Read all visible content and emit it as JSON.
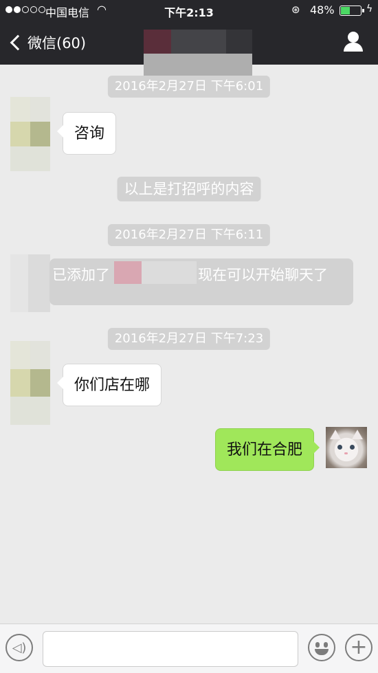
{
  "status_bar": {
    "signal_dots_filled": 2,
    "signal_dots_total": 5,
    "carrier": "中国电信",
    "time": "下午2:13",
    "battery_percent": "48%",
    "battery_level": 0.48,
    "wifi_icon": "wifi-icon",
    "lock_icon": "rotation-lock-icon"
  },
  "nav": {
    "back_label": "微信(60)",
    "profile_icon": "person-icon"
  },
  "messages": [
    {
      "type": "timestamp",
      "text": "2016年2月27日 下午6:01"
    },
    {
      "type": "received",
      "text": "咨询"
    },
    {
      "type": "system",
      "text": "以上是打招呼的内容"
    },
    {
      "type": "timestamp",
      "text": "2016年2月27日 下午6:11"
    },
    {
      "type": "system",
      "text_start": "已添加了",
      "text_end": "现在可以开始聊天了"
    },
    {
      "type": "timestamp",
      "text": "2016年2月27日 下午7:23"
    },
    {
      "type": "received",
      "text": "你们店在哪"
    },
    {
      "type": "sent",
      "text": "我们在合肥"
    }
  ],
  "input_bar": {
    "voice_icon": "voice-icon",
    "emoji_icon": "emoji-icon",
    "plus_icon": "plus-icon",
    "input_value": ""
  },
  "colors": {
    "nav_bg": "#27272b",
    "chat_bg": "#ebebeb",
    "sent_bubble": "#a0e75a",
    "received_bubble": "#ffffff",
    "system_bg": "#d2d2d2"
  }
}
